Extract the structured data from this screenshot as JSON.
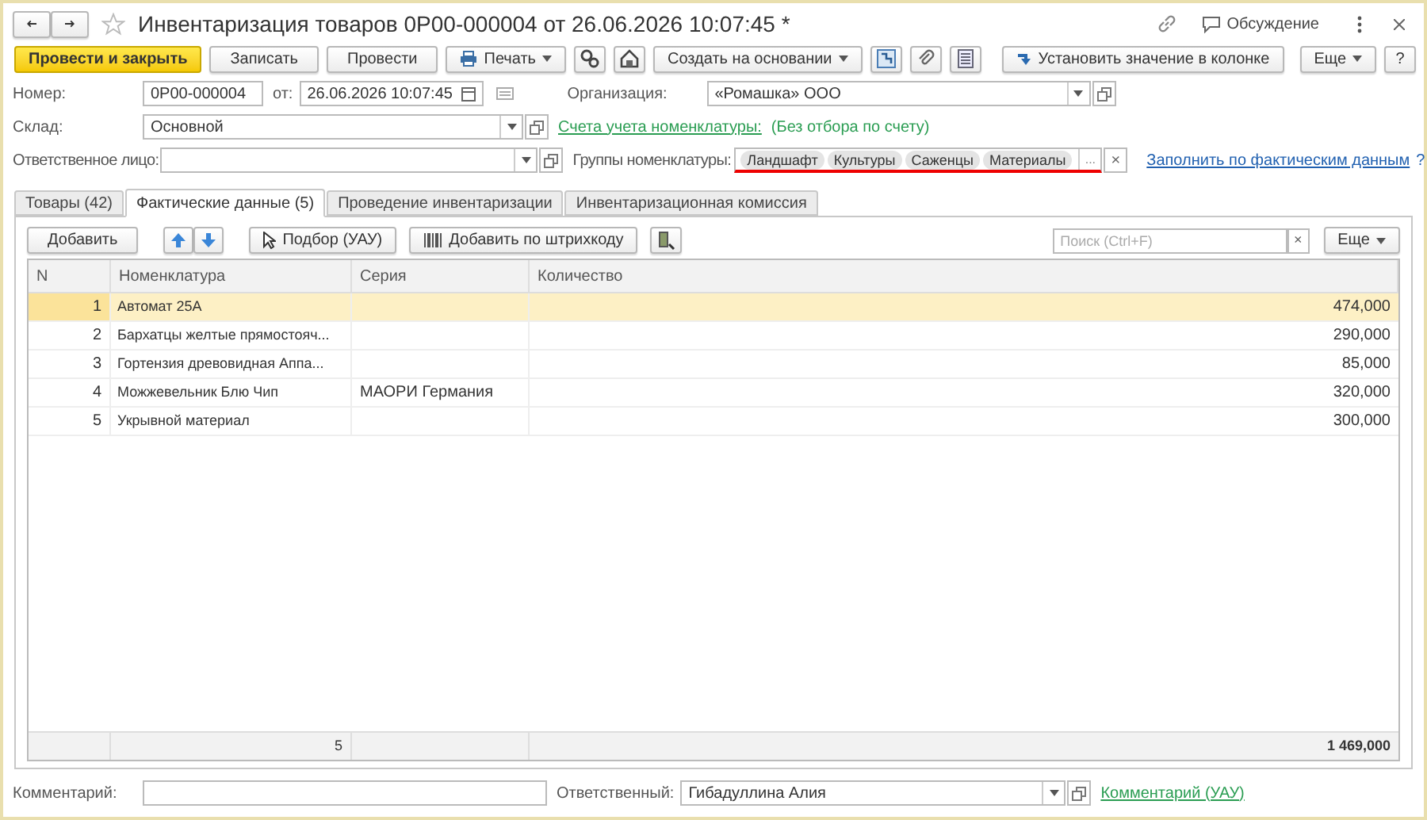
{
  "window": {
    "title": "Инвентаризация товаров 0Р00-000004 от 26.06.2026 10:07:45 *",
    "discussion": "Обсуждение"
  },
  "toolbar": {
    "buttons": [
      {
        "label": "Провести и закрыть",
        "kind": "primary"
      },
      {
        "label": "Записать",
        "kind": "plain"
      },
      {
        "label": "Провести",
        "kind": "plain"
      },
      {
        "label": "Печать",
        "kind": "print"
      },
      {
        "kind": "icon-gears"
      },
      {
        "kind": "icon-house"
      },
      {
        "label": "Создать на основании",
        "kind": "dropdown"
      },
      {
        "kind": "icon-structure"
      },
      {
        "kind": "icon-clip"
      },
      {
        "kind": "icon-list"
      },
      {
        "label": "Установить значение в колонке",
        "kind": "arrow"
      }
    ],
    "more": "Еще",
    "help": "?"
  },
  "header": {
    "number_label": "Номер:",
    "number": "0Р00-000004",
    "date_label": "от:",
    "date": "26.06.2026 10:07:45",
    "org_label": "Организация:",
    "org": "«Ромашка» ООО",
    "warehouse_label": "Склад:",
    "warehouse": "Основной",
    "accounts_link": "Счета учета номенклатуры:",
    "accounts_note": "(Без отбора по счету)",
    "responsible_label": "Ответственное лицо:",
    "groups_label": "Группы номенклатуры:",
    "groups": [
      "Ландшафт",
      "Культуры",
      "Саженцы",
      "Материалы"
    ],
    "groups_more": "...",
    "groups_clear": "×",
    "fill_link": "Заполнить по фактическим данным",
    "fill_help": "?"
  },
  "tabs": [
    {
      "label": "Товары (42)",
      "selected": false
    },
    {
      "label": "Фактические данные (5)",
      "selected": true
    },
    {
      "label": "Проведение инвентаризации",
      "selected": false
    },
    {
      "label": "Инвентаризационная комиссия",
      "selected": false
    }
  ],
  "table_toolbar": {
    "add": "Добавить",
    "pick": "Подбор (УАУ)",
    "barcode": "Добавить по штрихкоду",
    "search_placeholder": "Поиск (Ctrl+F)",
    "search_clear": "×",
    "more": "Еще"
  },
  "table": {
    "columns": [
      "N",
      "Номенклатура",
      "Серия",
      "Количество"
    ],
    "rows": [
      {
        "n": "1",
        "item": "Автомат 25А",
        "series": "",
        "qty": "474,000",
        "selected": true
      },
      {
        "n": "2",
        "item": "Бархатцы желтые прямостояч...",
        "series": "",
        "qty": "290,000",
        "selected": false
      },
      {
        "n": "3",
        "item": "Гортензия  древовидная Аппа...",
        "series": "",
        "qty": "85,000",
        "selected": false
      },
      {
        "n": "4",
        "item": "Можжевельник Блю Чип",
        "series": "МАОРИ Германия",
        "qty": "320,000",
        "selected": false
      },
      {
        "n": "5",
        "item": "Укрывной материал",
        "series": "",
        "qty": "300,000",
        "selected": false
      }
    ],
    "footer": {
      "count": "5",
      "total": "1 469,000"
    }
  },
  "bottom": {
    "comment_label": "Комментарий:",
    "responsible_label": "Ответственный:",
    "responsible": "Гибадуллина Алия",
    "comment_link": "Комментарий (УАУ)"
  }
}
